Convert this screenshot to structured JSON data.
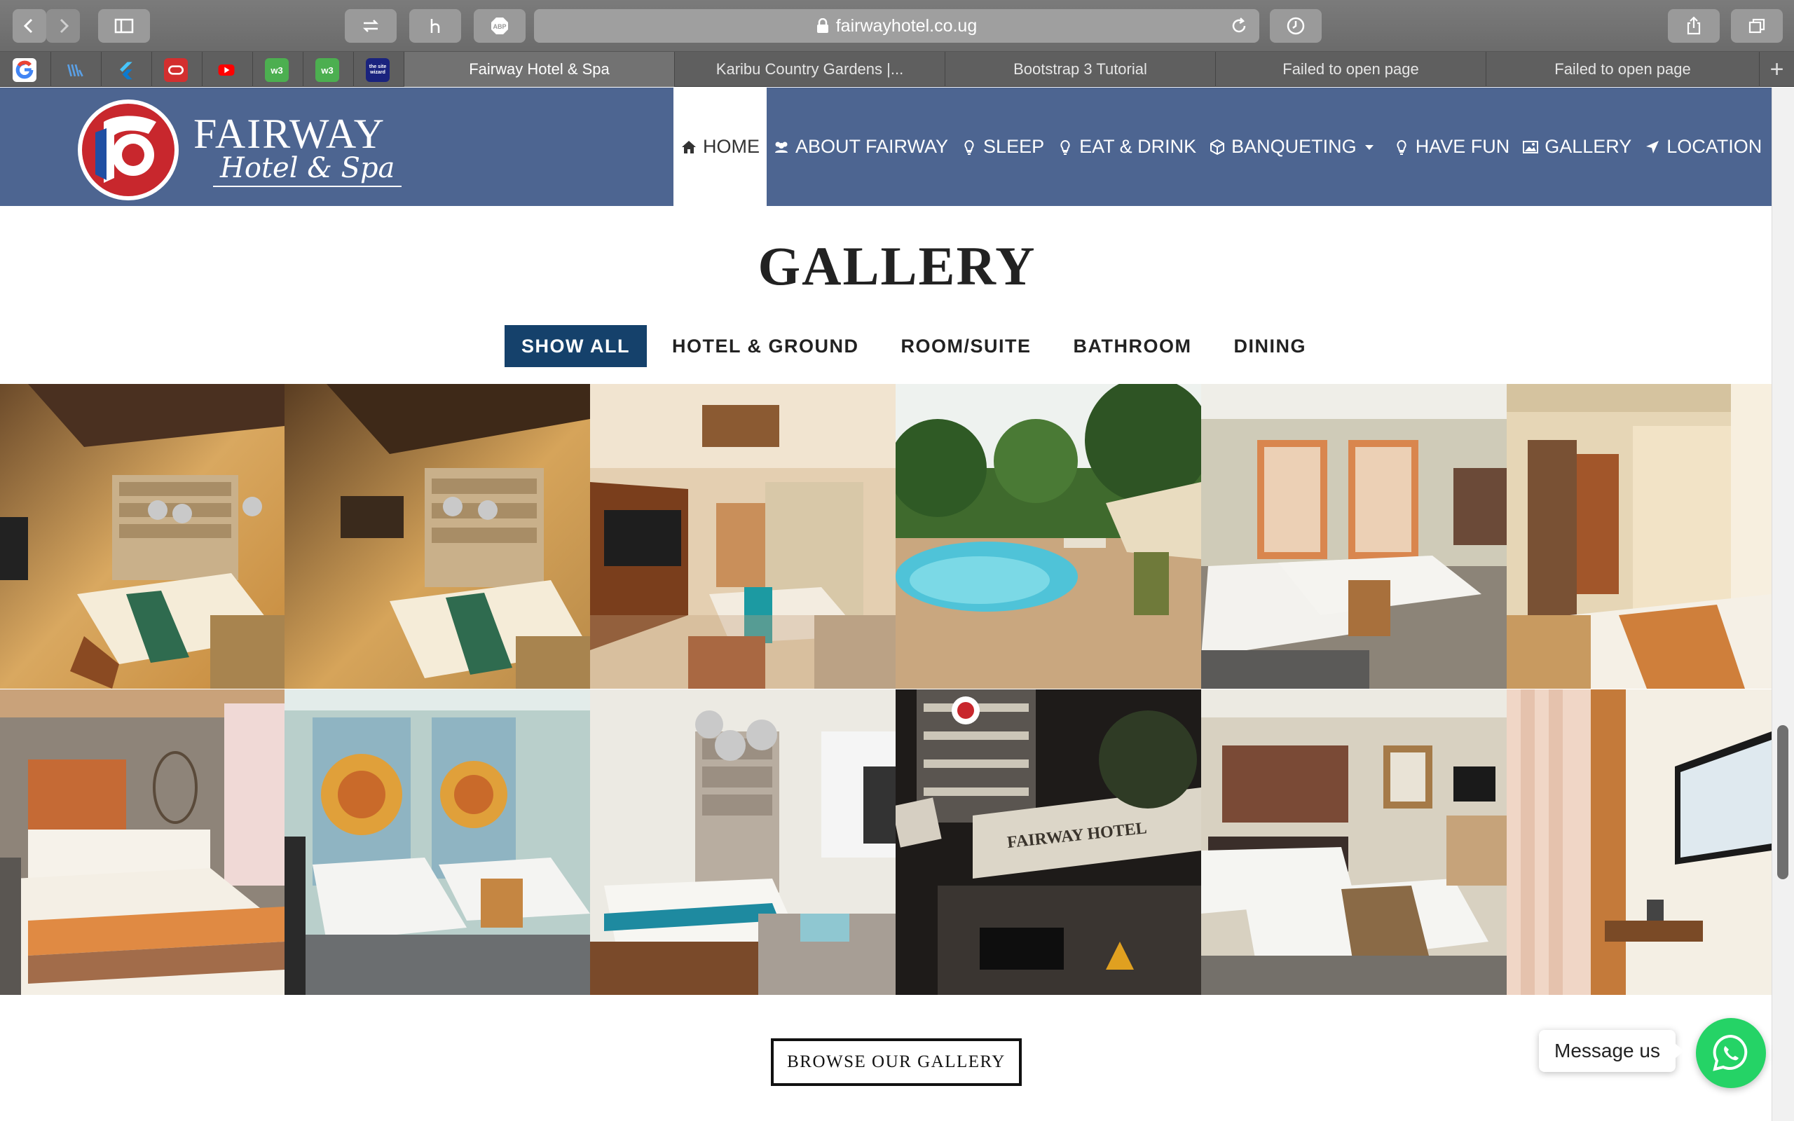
{
  "browser": {
    "url": "fairwayhotel.co.ug",
    "tabs": [
      {
        "label": "Fairway Hotel & Spa",
        "active": true
      },
      {
        "label": "Karibu Country Gardens |..."
      },
      {
        "label": "Bootstrap 3 Tutorial"
      },
      {
        "label": "Failed to open page"
      },
      {
        "label": "Failed to open page"
      }
    ],
    "favorites": [
      "google-icon",
      "library-icon",
      "flutter-icon",
      "oracle-icon",
      "youtube-icon",
      "w3-icon",
      "w3-icon",
      "thesitewizard-icon"
    ],
    "favorite_text": {
      "w3a": "w3",
      "w3b": "w3",
      "wizard": "the site wizard"
    }
  },
  "site": {
    "logo": {
      "word": "FAIRWAY",
      "sub": "Hotel & Spa"
    },
    "nav": [
      {
        "label": "HOME",
        "icon": "home-icon",
        "active": true
      },
      {
        "label": "ABOUT FAIRWAY",
        "icon": "users-icon"
      },
      {
        "label": "SLEEP",
        "icon": "bulb-icon"
      },
      {
        "label": "EAT & DRINK",
        "icon": "bulb-icon"
      },
      {
        "label": "BANQUETING",
        "icon": "cube-icon",
        "dropdown": true
      },
      {
        "label": "HAVE FUN",
        "icon": "bulb-icon"
      },
      {
        "label": "GALLERY",
        "icon": "image-icon"
      },
      {
        "label": "LOCATION",
        "icon": "location-arrow-icon"
      }
    ],
    "colors": {
      "header": "#4d6591",
      "filter_active": "#15416b",
      "whatsapp": "#25d366"
    }
  },
  "gallery": {
    "title": "GALLERY",
    "filters": [
      {
        "label": "SHOW ALL",
        "active": true
      },
      {
        "label": "HOTEL & GROUND"
      },
      {
        "label": "ROOM/SUITE"
      },
      {
        "label": "BATHROOM"
      },
      {
        "label": "DINING"
      }
    ],
    "images": [
      {
        "scene": "bedroom",
        "category": "ROOM/SUITE"
      },
      {
        "scene": "bedroom",
        "category": "ROOM/SUITE"
      },
      {
        "scene": "suite",
        "category": "ROOM/SUITE"
      },
      {
        "scene": "pool",
        "category": "HOTEL & GROUND"
      },
      {
        "scene": "twin-room",
        "category": "ROOM/SUITE"
      },
      {
        "scene": "room-door",
        "category": "ROOM/SUITE"
      },
      {
        "scene": "bedroom",
        "category": "ROOM/SUITE"
      },
      {
        "scene": "twin-room",
        "category": "ROOM/SUITE"
      },
      {
        "scene": "suite",
        "category": "ROOM/SUITE"
      },
      {
        "scene": "hotel-exterior",
        "category": "HOTEL & GROUND",
        "sign": "FAIRWAY HOTEL"
      },
      {
        "scene": "twin-room",
        "category": "ROOM/SUITE"
      },
      {
        "scene": "room-tv",
        "category": "ROOM/SUITE"
      }
    ],
    "browse_label": "BROWSE OUR GALLERY"
  },
  "chat": {
    "label": "Message us",
    "icon": "whatsapp-icon"
  }
}
